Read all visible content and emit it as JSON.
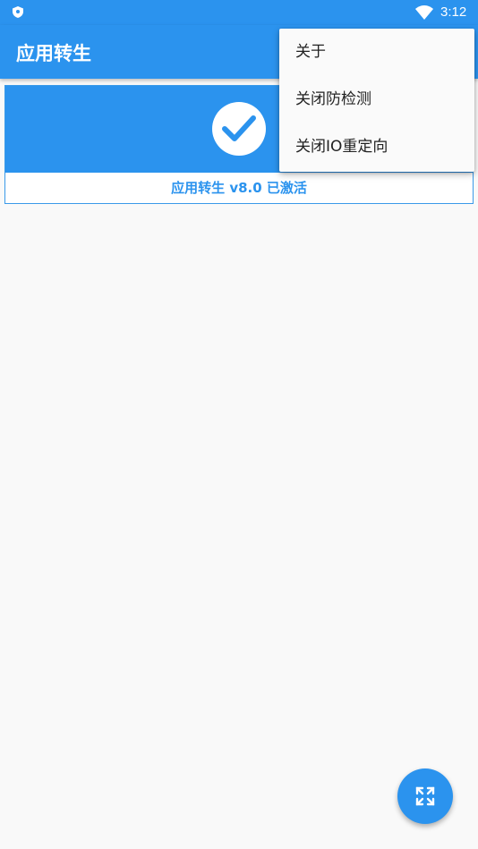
{
  "status_bar": {
    "time": "3:12",
    "icons": [
      "shield-icon",
      "wifi-icon"
    ]
  },
  "app_bar": {
    "title": "应用转生"
  },
  "status_card": {
    "icon": "check-circle-icon",
    "text": "应用转生 v8.0 已激活"
  },
  "overflow_menu": {
    "items": [
      {
        "label": "关于"
      },
      {
        "label": "关闭防检测"
      },
      {
        "label": "关闭IO重定向"
      }
    ]
  },
  "fab": {
    "icon": "expand-icon"
  },
  "colors": {
    "primary": "#2b93ee",
    "background": "#f9f9f9",
    "menu_background": "#fafafa"
  }
}
